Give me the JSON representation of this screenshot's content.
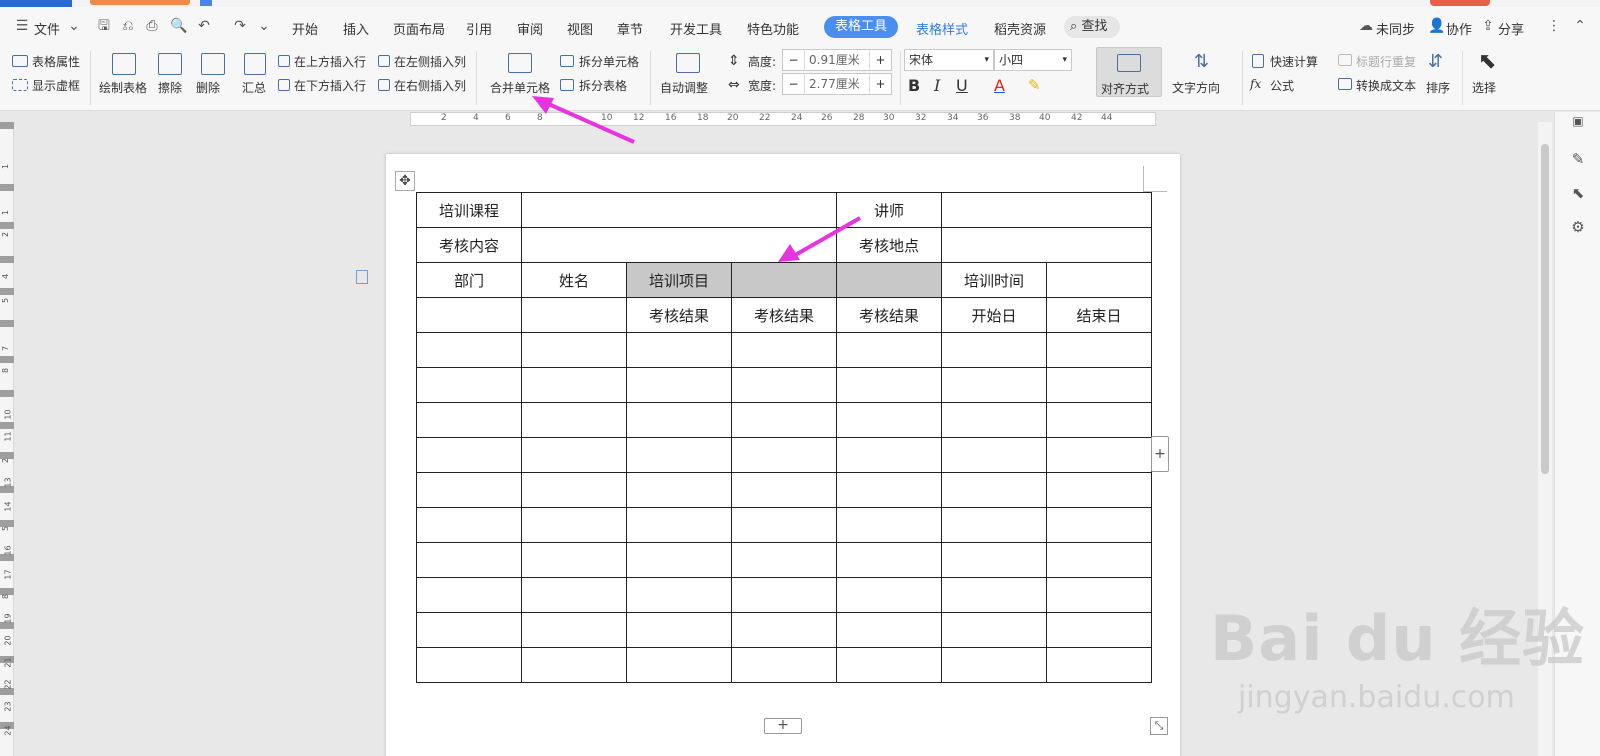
{
  "menu": {
    "file": "文件",
    "tabs": [
      "开始",
      "插入",
      "页面布局",
      "引用",
      "审阅",
      "视图",
      "章节",
      "开发工具",
      "特色功能"
    ],
    "active_tab": "表格工具",
    "table_style_tab": "表格样式",
    "resources_tab": "稻壳资源",
    "search": "查找",
    "right": {
      "unsync": "未同步",
      "collab": "协作",
      "share": "分享"
    }
  },
  "ribbon": {
    "table_props": "表格属性",
    "show_grid": "显示虚框",
    "draw_table": "绘制表格",
    "erase": "擦除",
    "delete": "删除",
    "summary": "汇总",
    "insert_above": "在上方插入行",
    "insert_below": "在下方插入行",
    "insert_left": "在左侧插入列",
    "insert_right": "在右侧插入列",
    "merge_cells": "合并单元格",
    "split_cells": "拆分单元格",
    "split_table": "拆分表格",
    "auto_adjust": "自动调整",
    "height_label": "高度:",
    "height_value": "0.91厘米",
    "width_label": "宽度:",
    "width_value": "2.77厘米",
    "font_name": "宋体",
    "font_size": "小四",
    "align": "对齐方式",
    "text_direction": "文字方向",
    "quick_calc": "快速计算",
    "title_repeat": "标题行重复",
    "formula": "公式",
    "to_text": "转换成文本",
    "sort": "排序",
    "select": "选择"
  },
  "ruler_labels": [
    "2",
    "4",
    "6",
    "8",
    "10",
    "12",
    "16",
    "18",
    "20",
    "22",
    "24",
    "26",
    "28",
    "30",
    "32",
    "34",
    "36",
    "38",
    "40",
    "42",
    "44"
  ],
  "vruler_labels": [
    "1",
    "1",
    "2",
    "4",
    "5",
    "7",
    "8",
    "10",
    "11",
    "2",
    "13",
    "14",
    "5",
    "16",
    "17",
    "8",
    "19",
    "20",
    "21",
    "22",
    "23",
    "24"
  ],
  "table": {
    "rows": [
      [
        "培训课程",
        "",
        "",
        "",
        "讲师",
        "",
        ""
      ],
      [
        "考核内容",
        "",
        "",
        "",
        "考核地点",
        "",
        ""
      ],
      [
        "部门",
        "姓名",
        "培训项目",
        "",
        "",
        "培训时间",
        ""
      ],
      [
        "",
        "",
        "考核结果",
        "考核结果",
        "考核结果",
        "开始日",
        "结束日"
      ],
      [
        "",
        "",
        "",
        "",
        "",
        "",
        ""
      ],
      [
        "",
        "",
        "",
        "",
        "",
        "",
        ""
      ],
      [
        "",
        "",
        "",
        "",
        "",
        "",
        ""
      ],
      [
        "",
        "",
        "",
        "",
        "",
        "",
        ""
      ],
      [
        "",
        "",
        "",
        "",
        "",
        "",
        ""
      ],
      [
        "",
        "",
        "",
        "",
        "",
        "",
        ""
      ],
      [
        "",
        "",
        "",
        "",
        "",
        "",
        ""
      ],
      [
        "",
        "",
        "",
        "",
        "",
        "",
        ""
      ],
      [
        "",
        "",
        "",
        "",
        "",
        "",
        ""
      ],
      [
        "",
        "",
        "",
        "",
        "",
        "",
        ""
      ]
    ],
    "selected_cells_note": "row 3 cells 3-5 selected"
  },
  "watermark": {
    "main": "Bai du 经验",
    "sub": "jingyan.baidu.com"
  },
  "colors": {
    "accent": "#4a8ef0",
    "arrow": "#e833e0",
    "selection": "#c8c8c8"
  }
}
